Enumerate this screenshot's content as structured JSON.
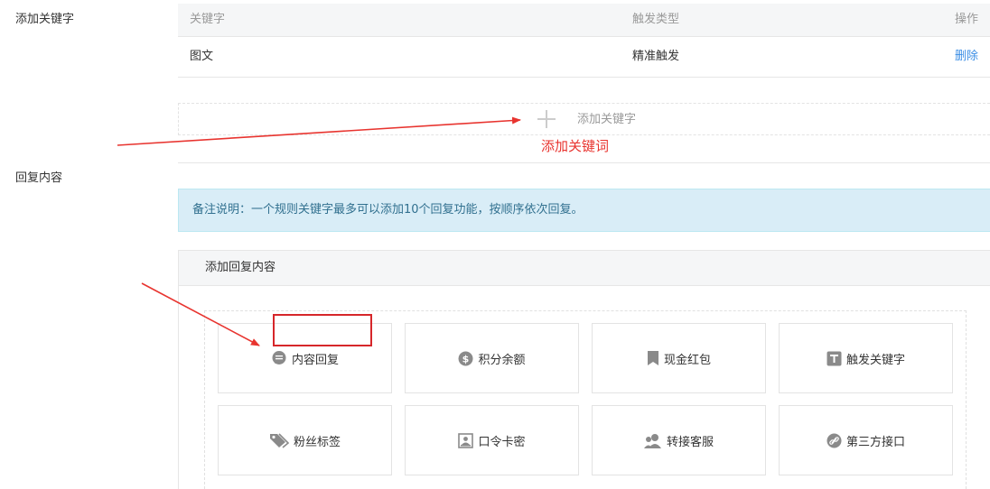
{
  "labels": {
    "add_keyword": "添加关键字",
    "reply_content": "回复内容"
  },
  "keyword_table": {
    "headers": [
      "关键字",
      "触发类型",
      "操作"
    ],
    "rows": [
      {
        "keyword": "图文",
        "trigger": "精准触发",
        "action": "删除"
      }
    ]
  },
  "add_keyword_button": "添加关键字",
  "annotation": "添加关键词",
  "note": "备注说明：一个规则关键字最多可以添加10个回复功能，按顺序依次回复。",
  "reply_panel": {
    "title": "添加回复内容",
    "options": [
      {
        "label": "内容回复",
        "icon": "chat-bubble-icon"
      },
      {
        "label": "积分余额",
        "icon": "dollar-coin-icon"
      },
      {
        "label": "现金红包",
        "icon": "bookmark-icon"
      },
      {
        "label": "触发关键字",
        "icon": "text-t-icon"
      },
      {
        "label": "粉丝标签",
        "icon": "tag-icon"
      },
      {
        "label": "口令卡密",
        "icon": "card-icon"
      },
      {
        "label": "转接客服",
        "icon": "users-icon"
      },
      {
        "label": "第三方接口",
        "icon": "link-icon"
      }
    ]
  },
  "colors": {
    "link": "#3b8ee5",
    "annotation_red": "#e8342f",
    "note_bg": "#d9edf7",
    "icon_gray": "#8a8a8a"
  }
}
